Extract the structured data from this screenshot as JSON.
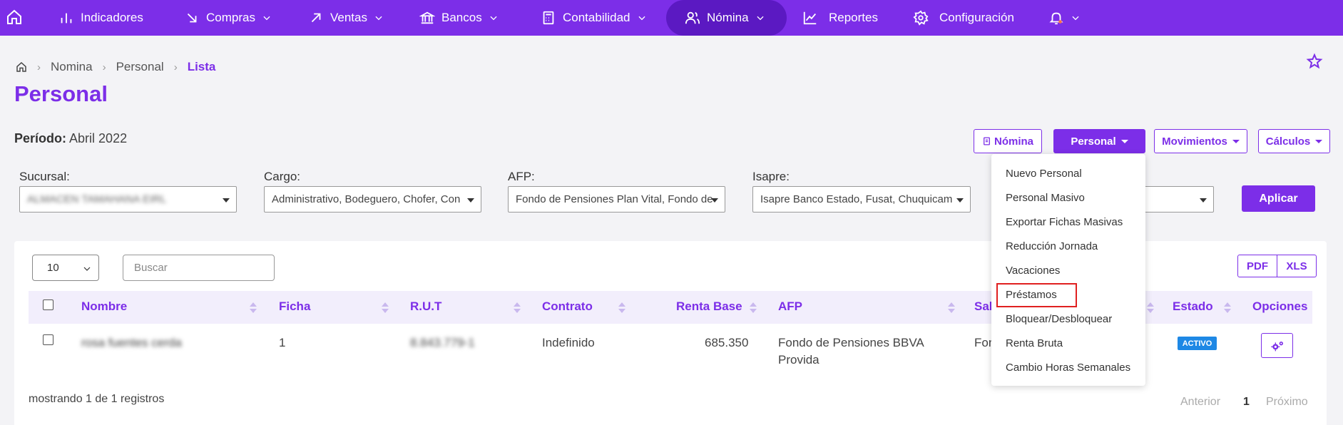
{
  "nav": {
    "items": [
      {
        "label": "Indicadores"
      },
      {
        "label": "Compras"
      },
      {
        "label": "Ventas"
      },
      {
        "label": "Bancos"
      },
      {
        "label": "Contabilidad"
      },
      {
        "label": "Nómina"
      },
      {
        "label": "Reportes"
      },
      {
        "label": "Configuración"
      }
    ]
  },
  "breadcrumb": [
    "Nomina",
    "Personal",
    "Lista"
  ],
  "page_title": "Personal",
  "periodo": {
    "label": "Período:",
    "value": "Abril 2022"
  },
  "actions": {
    "nomina": "Nómina",
    "personal": "Personal",
    "movimientos": "Movimientos",
    "calculos": "Cálculos"
  },
  "filters": {
    "sucursal": {
      "label": "Sucursal:",
      "value": "ALMACEN TAMAHANA EIRL"
    },
    "cargo": {
      "label": "Cargo:",
      "value": "Administrativo, Bodeguero, Chofer, Con"
    },
    "afp": {
      "label": "AFP:",
      "value": "Fondo de Pensiones Plan Vital, Fondo de"
    },
    "isapre": {
      "label": "Isapre:",
      "value": "Isapre Banco Estado, Fusat, Chuquicam"
    },
    "apply": "Aplicar"
  },
  "table_controls": {
    "page_length": "10",
    "search_placeholder": "Buscar",
    "export_pdf": "PDF",
    "export_xls": "XLS"
  },
  "columns": [
    "Nombre",
    "Ficha",
    "R.U.T",
    "Contrato",
    "Renta Base",
    "AFP",
    "Sal",
    "Estado",
    "Opciones"
  ],
  "rows": [
    {
      "nombre": "rosa fuentes cerda",
      "ficha": "1",
      "rut": "8.843.779-1",
      "contrato": "Indefinido",
      "renta_base": "685.350",
      "afp_line1": "Fondo de Pensiones BBVA",
      "afp_line2": "Provida",
      "salud": "Fon",
      "estado": "ACTIVO"
    }
  ],
  "footer": {
    "info": "mostrando 1 de 1 registros",
    "prev": "Anterior",
    "page": "1",
    "next": "Próximo"
  },
  "personal_menu": [
    "Nuevo Personal",
    "Personal Masivo",
    "Exportar Fichas Masivas",
    "Reducción Jornada",
    "Vacaciones",
    "Préstamos",
    "Bloquear/Desbloquear",
    "Renta Bruta",
    "Cambio Horas Semanales"
  ],
  "colors": {
    "primary": "#7c2ee8",
    "nav_active": "#5b19c2",
    "badge": "#1e88e5",
    "highlight": "#e02020"
  }
}
